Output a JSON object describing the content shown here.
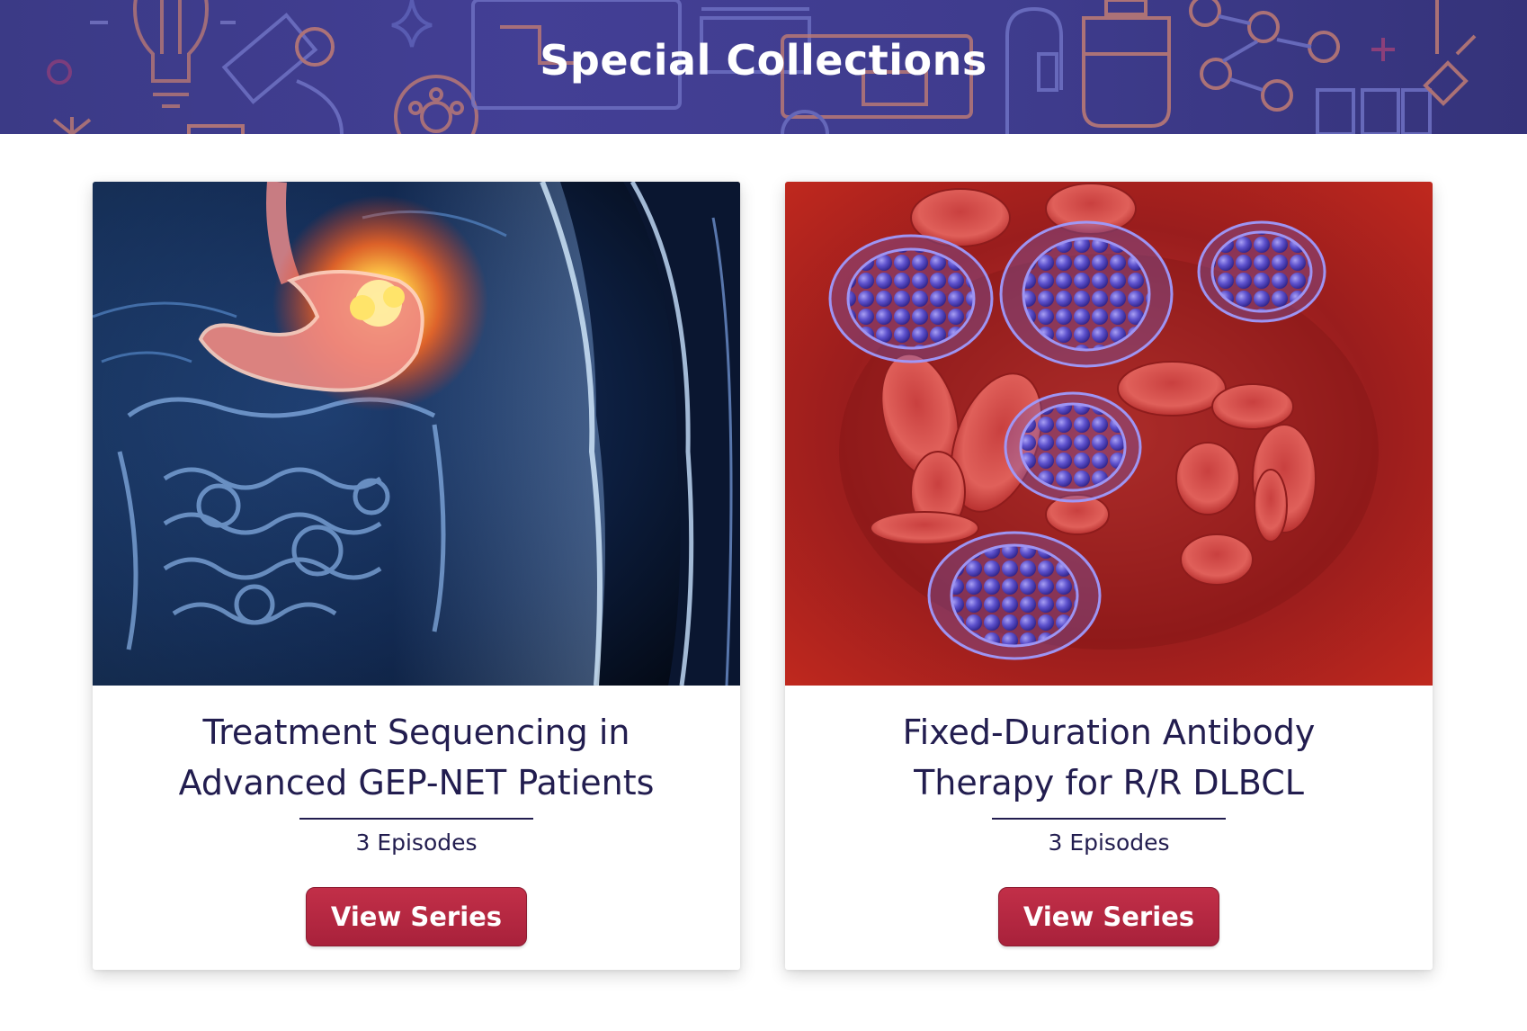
{
  "header": {
    "title": "Special Collections"
  },
  "cards": [
    {
      "title_line1": "Treatment Sequencing in",
      "title_line2": "Advanced GEP-NET Patients",
      "episodes": "3 Episodes",
      "button_label": "View Series",
      "image": "abdominal-xray-stomach-tumor-illustration"
    },
    {
      "title_line1": "Fixed-Duration Antibody",
      "title_line2": "Therapy for R/R DLBCL",
      "episodes": "3 Episodes",
      "button_label": "View Series",
      "image": "blood-vessel-red-cells-lymphoma-cells-illustration"
    }
  ],
  "colors": {
    "banner": "#3f3c8e",
    "title_text": "#221d4f",
    "button": "#b5283f"
  }
}
